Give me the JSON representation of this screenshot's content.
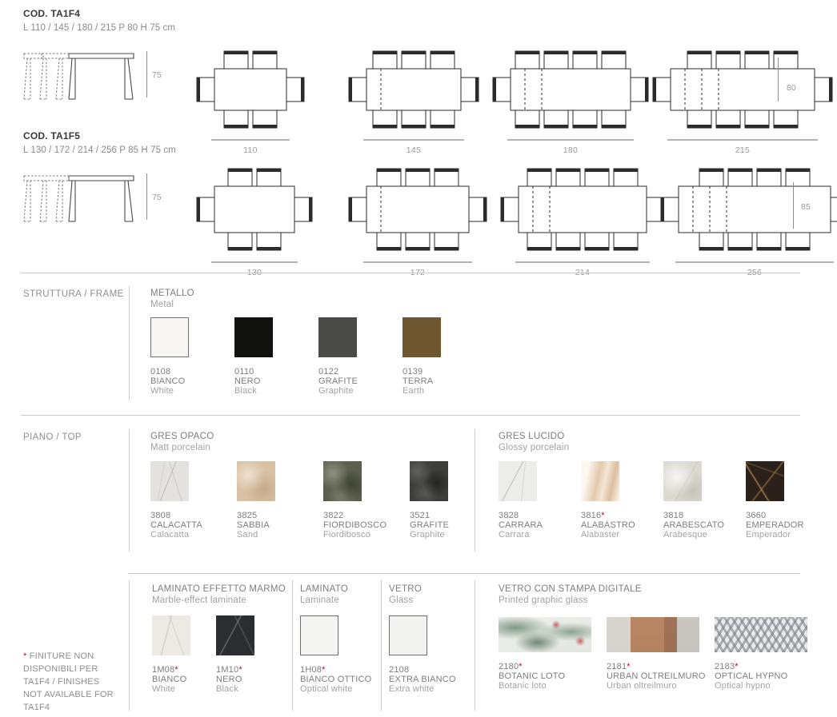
{
  "models": [
    {
      "code": "COD. TA1F4",
      "dims": "L 110 / 145 / 180 / 215 P 80 H 75 cm",
      "height_label": "75",
      "depth_label": "80",
      "plans": [
        {
          "width_label": "110",
          "chairs_per_side": 2,
          "ext_lines": 0
        },
        {
          "width_label": "145",
          "chairs_per_side": 3,
          "ext_lines": 1
        },
        {
          "width_label": "180",
          "chairs_per_side": 4,
          "ext_lines": 2
        },
        {
          "width_label": "215",
          "chairs_per_side": 4,
          "ext_lines": 3
        }
      ]
    },
    {
      "code": "COD. TA1F5",
      "dims": "L 130 / 172 / 214 / 256 P 85 H 75 cm",
      "height_label": "75",
      "depth_label": "85",
      "plans": [
        {
          "width_label": "130",
          "chairs_per_side": 2,
          "ext_lines": 0
        },
        {
          "width_label": "172",
          "chairs_per_side": 3,
          "ext_lines": 1
        },
        {
          "width_label": "214",
          "chairs_per_side": 4,
          "ext_lines": 2
        },
        {
          "width_label": "256",
          "chairs_per_side": 4,
          "ext_lines": 3
        }
      ]
    }
  ],
  "frame": {
    "section_label": "STRUTTURA / FRAME",
    "group_it": "METALLO",
    "group_en": "Metal",
    "items": [
      {
        "code": "0108",
        "name": "BIANCO",
        "name_en": "White",
        "color": "#f7f6f3",
        "bordered": true,
        "starred": false
      },
      {
        "code": "0110",
        "name": "NERO",
        "name_en": "Black",
        "color": "#111110",
        "bordered": false,
        "starred": false
      },
      {
        "code": "0122",
        "name": "GRAFITE",
        "name_en": "Graphite",
        "color": "#4a4a48",
        "bordered": false,
        "starred": false
      },
      {
        "code": "0139",
        "name": "TERRA",
        "name_en": "Earth",
        "color": "#6e5730",
        "bordered": false,
        "starred": false
      }
    ]
  },
  "top": {
    "section_label": "PIANO / TOP",
    "gres_opaco": {
      "group_it": "GRES OPACO",
      "group_en": "Matt porcelain",
      "items": [
        {
          "code": "3808",
          "name": "CALACATTA",
          "name_en": "Calacatta",
          "color": "#e3e2de",
          "starred": false
        },
        {
          "code": "3825",
          "name": "SABBIA",
          "name_en": "Sand",
          "color": "#d9c2a4",
          "starred": false
        },
        {
          "code": "3822",
          "name": "FIORDIBOSCO",
          "name_en": "Fiordibosco",
          "color": "#5c5f4e",
          "starred": false
        },
        {
          "code": "3521",
          "name": "GRAFITE",
          "name_en": "Graphite",
          "color": "#3d3d3b",
          "starred": false
        }
      ]
    },
    "gres_lucido": {
      "group_it": "GRES LUCIDO",
      "group_en": "Glossy porcelain",
      "items": [
        {
          "code": "3828",
          "name": "CARRARA",
          "name_en": "Carrara",
          "color": "#ececea",
          "starred": false
        },
        {
          "code": "3816",
          "name": "ALABASTRO",
          "name_en": "Alabaster",
          "color": "#e6d3bd",
          "starred": true
        },
        {
          "code": "3818",
          "name": "ARABESCATO",
          "name_en": "Arabesque",
          "color": "#dcd9d0",
          "starred": false
        },
        {
          "code": "3660",
          "name": "EMPERADOR",
          "name_en": "Emperador",
          "color": "#2a211a",
          "starred": false
        }
      ]
    },
    "laminato_marmo": {
      "group_it": "LAMINATO EFFETTO MARMO",
      "group_en": "Marble-effect laminate",
      "items": [
        {
          "code": "1M08",
          "name": "BIANCO",
          "name_en": "White",
          "color": "#edeae4",
          "starred": true
        },
        {
          "code": "1M10",
          "name": "NERO",
          "name_en": "Black",
          "color": "#2b2d30",
          "starred": true
        }
      ]
    },
    "laminato": {
      "group_it": "LAMINATO",
      "group_en": "Laminate",
      "items": [
        {
          "code": "1H08",
          "name": "BIANCO OTTICO",
          "name_en": "Optical white",
          "color": "#f4f4f2",
          "bordered": true,
          "starred": true
        }
      ]
    },
    "vetro": {
      "group_it": "VETRO",
      "group_en": "Glass",
      "items": [
        {
          "code": "2108",
          "name": "EXTRA BIANCO",
          "name_en": "Extra white",
          "color": "#f2f2f0",
          "bordered": true,
          "starred": false
        }
      ]
    },
    "vetro_stampa": {
      "group_it": "VETRO CON STAMPA DIGITALE",
      "group_en": "Printed graphic glass",
      "items": [
        {
          "code": "2180",
          "name": "BOTANIC LOTO",
          "name_en": "Botanic loto",
          "pattern": "botanic",
          "starred": true
        },
        {
          "code": "2181",
          "name": "URBAN OLTREILMURO",
          "name_en": "Urban oltreilmuro",
          "pattern": "urban",
          "starred": true
        },
        {
          "code": "2183",
          "name": "OPTICAL HYPNO",
          "name_en": "Optical hypno",
          "pattern": "optical",
          "starred": true
        }
      ]
    }
  },
  "footnote": {
    "asterisk": "*",
    "text": " FINITURE NON DISPONIBILI PER TA1F4 / FINISHES NOT AVAILABLE FOR TA1F4"
  },
  "colors": {
    "accent_red": "#d0021b",
    "rule": "#c9c9c9",
    "text_grey": "#7d7d7d",
    "text_light": "#a2a2a2"
  }
}
